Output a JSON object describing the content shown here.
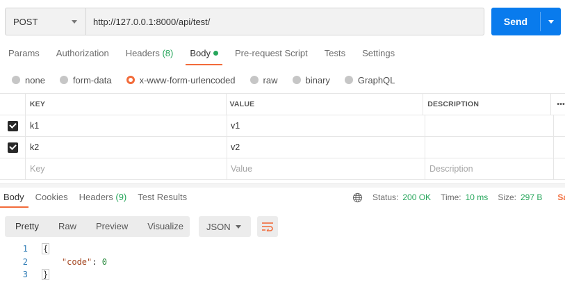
{
  "request": {
    "method": "POST",
    "url": "http://127.0.0.1:8000/api/test/",
    "send_label": "Send"
  },
  "request_tabs": [
    {
      "label": "Params"
    },
    {
      "label": "Authorization"
    },
    {
      "label": "Headers",
      "count": "(8)"
    },
    {
      "label": "Body",
      "active": true
    },
    {
      "label": "Pre-request Script"
    },
    {
      "label": "Tests"
    },
    {
      "label": "Settings"
    }
  ],
  "body_types": [
    {
      "label": "none"
    },
    {
      "label": "form-data"
    },
    {
      "label": "x-www-form-urlencoded",
      "selected": true
    },
    {
      "label": "raw"
    },
    {
      "label": "binary"
    },
    {
      "label": "GraphQL"
    }
  ],
  "params_table": {
    "headers": [
      "KEY",
      "VALUE",
      "DESCRIPTION",
      "•••"
    ],
    "rows": [
      {
        "key": "k1",
        "value": "v1",
        "description": "",
        "checked": true
      },
      {
        "key": "k2",
        "value": "v2",
        "description": "",
        "checked": true
      }
    ],
    "placeholder": {
      "key": "Key",
      "value": "Value",
      "description": "Description"
    }
  },
  "response_tabs": [
    {
      "label": "Body",
      "active": true
    },
    {
      "label": "Cookies"
    },
    {
      "label": "Headers",
      "count": "(9)"
    },
    {
      "label": "Test Results"
    }
  ],
  "response_status": {
    "status_label": "Status:",
    "status_value": "200 OK",
    "time_label": "Time:",
    "time_value": "10 ms",
    "size_label": "Size:",
    "size_value": "297 B",
    "save_label": "Save"
  },
  "view_modes": [
    "Pretty",
    "Raw",
    "Preview",
    "Visualize"
  ],
  "format": "JSON",
  "code_lines": [
    {
      "n": "1",
      "text": "{"
    },
    {
      "n": "2",
      "key": "\"code\"",
      "sep": ": ",
      "value": "0"
    },
    {
      "n": "3",
      "text": "}"
    }
  ],
  "colors": {
    "accent": "#f26b3a",
    "send": "#097bed",
    "success": "#26a65b"
  }
}
